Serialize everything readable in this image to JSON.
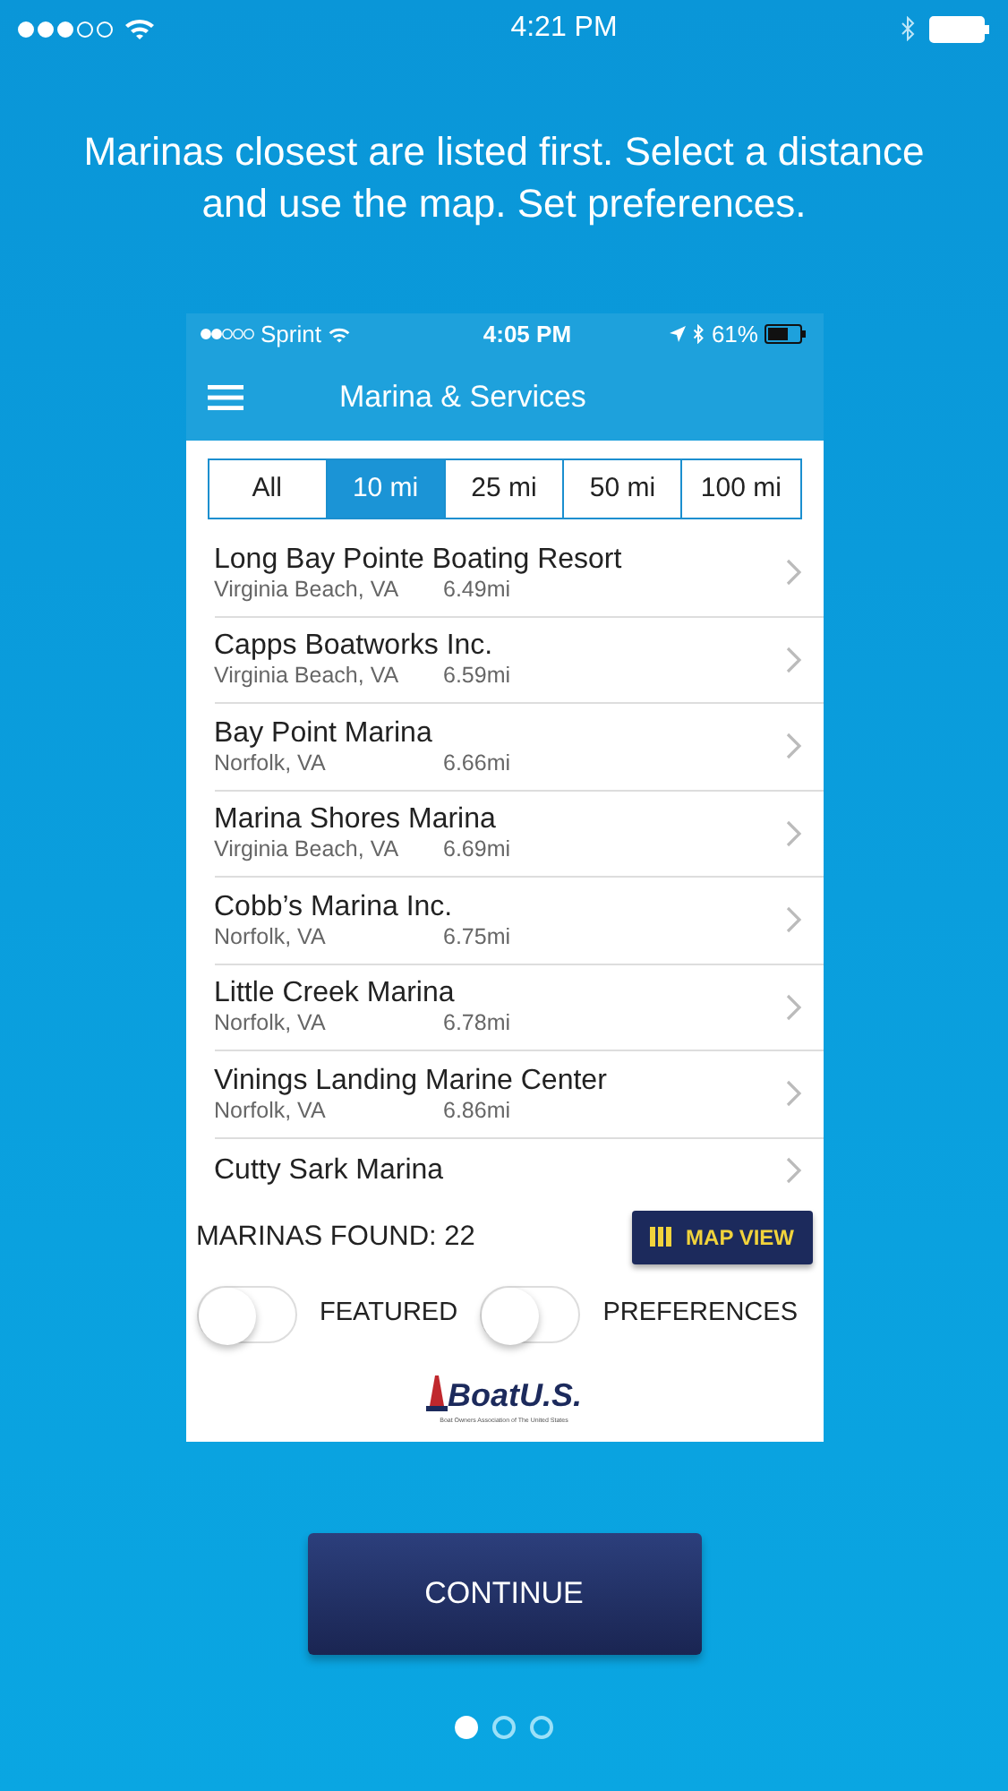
{
  "status_bar": {
    "time": "4:21 PM"
  },
  "headline": "Marinas closest are listed first. Select a distance and use the map. Set preferences.",
  "phone": {
    "status_bar": {
      "carrier": "Sprint",
      "time": "4:05 PM",
      "battery": "61%"
    },
    "title": "Marina & Services",
    "distance_tabs": [
      {
        "label": "All",
        "selected": false
      },
      {
        "label": "10 mi",
        "selected": true
      },
      {
        "label": "25 mi",
        "selected": false
      },
      {
        "label": "50 mi",
        "selected": false
      },
      {
        "label": "100 mi",
        "selected": false
      }
    ],
    "marinas": [
      {
        "name": "Long Bay Pointe Boating Resort",
        "location": "Virginia Beach, VA",
        "distance": "6.49mi"
      },
      {
        "name": "Capps Boatworks Inc.",
        "location": "Virginia Beach, VA",
        "distance": "6.59mi"
      },
      {
        "name": "Bay Point Marina",
        "location": "Norfolk, VA",
        "distance": "6.66mi"
      },
      {
        "name": "Marina Shores Marina",
        "location": "Virginia Beach, VA",
        "distance": "6.69mi"
      },
      {
        "name": "Cobb’s Marina Inc.",
        "location": "Norfolk, VA",
        "distance": "6.75mi"
      },
      {
        "name": "Little Creek Marina",
        "location": "Norfolk, VA",
        "distance": "6.78mi"
      },
      {
        "name": "Vinings Landing Marine Center",
        "location": "Norfolk, VA",
        "distance": "6.86mi"
      },
      {
        "name": "Cutty Sark Marina"
      }
    ],
    "found": "MARINAS FOUND: 22",
    "map_button": "MAP VIEW",
    "toggles": [
      {
        "label": "FEATURED",
        "on": false
      },
      {
        "label": "PREFERENCES",
        "on": false
      }
    ],
    "logo": "BoatU.S.",
    "logo_tagline": "Boat Owners Association of The United States"
  },
  "continue": "CONTINUE",
  "pages": [
    {
      "selected": true
    },
    {
      "selected": false
    },
    {
      "selected": false
    }
  ]
}
